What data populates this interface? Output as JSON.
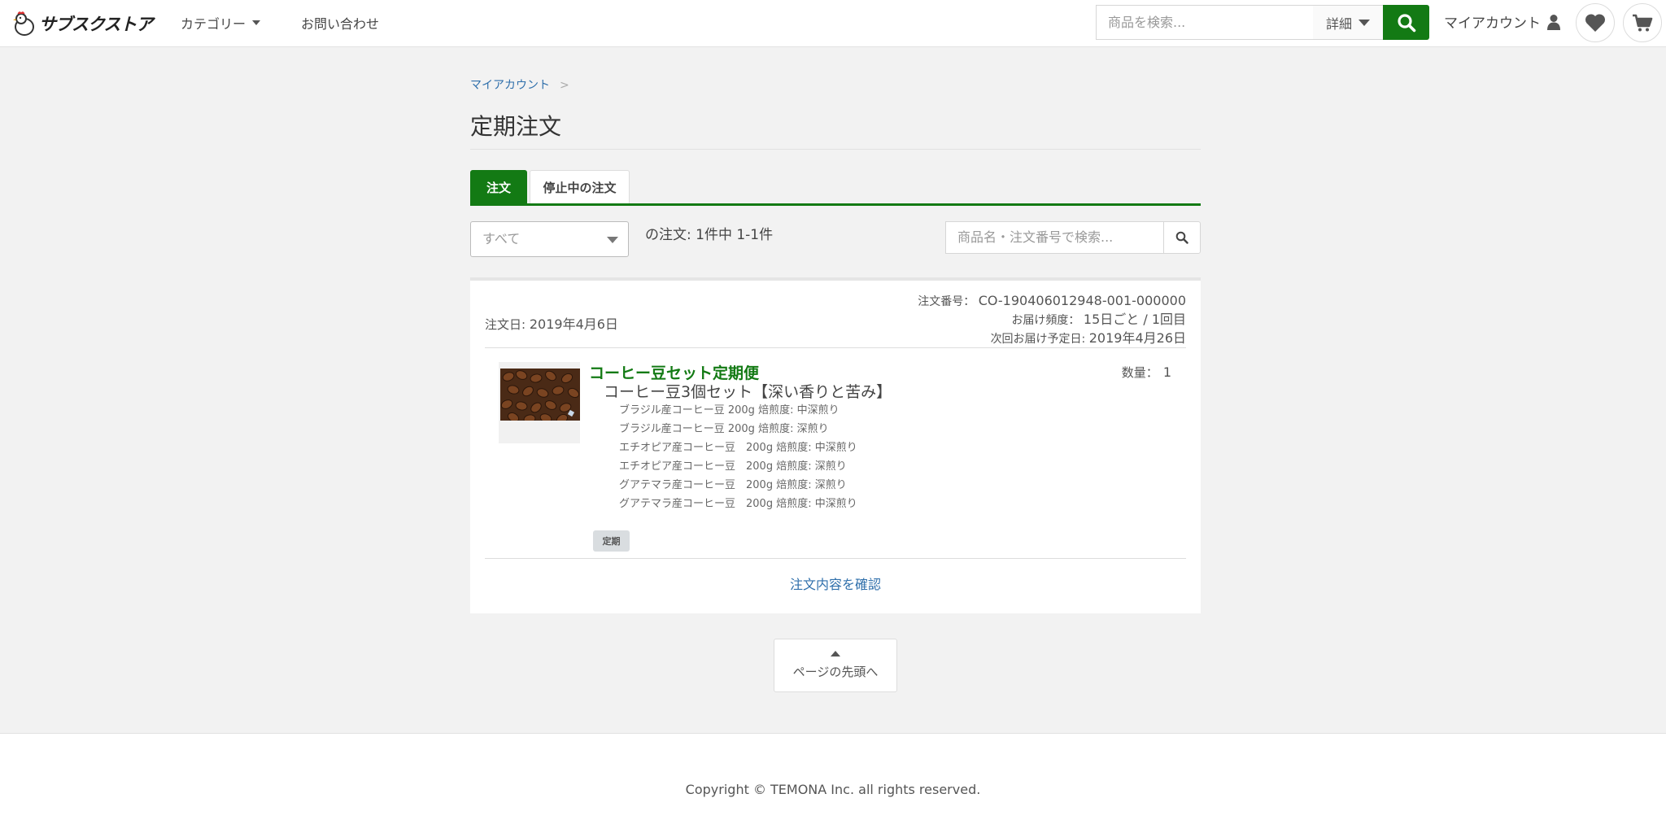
{
  "header": {
    "logo_text": "サブスクストア",
    "nav": {
      "category": "カテゴリー",
      "contact": "お問い合わせ"
    },
    "search": {
      "placeholder": "商品を検索...",
      "detail_label": "詳細"
    },
    "account_label": "マイアカウント",
    "accent_color": "#137a14"
  },
  "breadcrumb": {
    "items": [
      "マイアカウント"
    ],
    "separator": ">"
  },
  "page_title": "定期注文",
  "tabs": [
    {
      "label": "注文",
      "active": true
    },
    {
      "label": "停止中の注文",
      "active": false
    }
  ],
  "filters": {
    "status_select": "すべて",
    "order_count": "の注文: 1件中 1-1件",
    "search_placeholder": "商品名・注文番号で検索..."
  },
  "order": {
    "date_label": "注文日:",
    "date": "2019年4月6日",
    "number_label": "注文番号：",
    "number": "CO-190406012948-001-000000",
    "frequency_label": "お届け頻度：",
    "frequency": "15日ごと / 1回目",
    "next_label": "次回お届け予定日:",
    "next_date": "2019年4月26日",
    "product_name": "コーヒー豆セット定期便",
    "variant": "コーヒー豆3個セット【深い香りと苦み】",
    "quantity_label": "数量：",
    "quantity": "1",
    "items": [
      "ブラジル産コーヒー豆 200g 焙煎度: 中深煎り",
      "ブラジル産コーヒー豆 200g 焙煎度: 深煎り",
      "エチオピア産コーヒー豆　200g 焙煎度: 中深煎り",
      "エチオピア産コーヒー豆　200g 焙煎度: 深煎り",
      "グアテマラ産コーヒー豆　200g 焙煎度: 深煎り",
      "グアテマラ産コーヒー豆　200g 焙煎度: 中深煎り"
    ],
    "badge": "定期",
    "confirm_link": "注文内容を確認"
  },
  "back_to_top": "ページの先頭へ",
  "footer": {
    "copyright": "Copyright © TEMONA Inc. all rights reserved."
  }
}
